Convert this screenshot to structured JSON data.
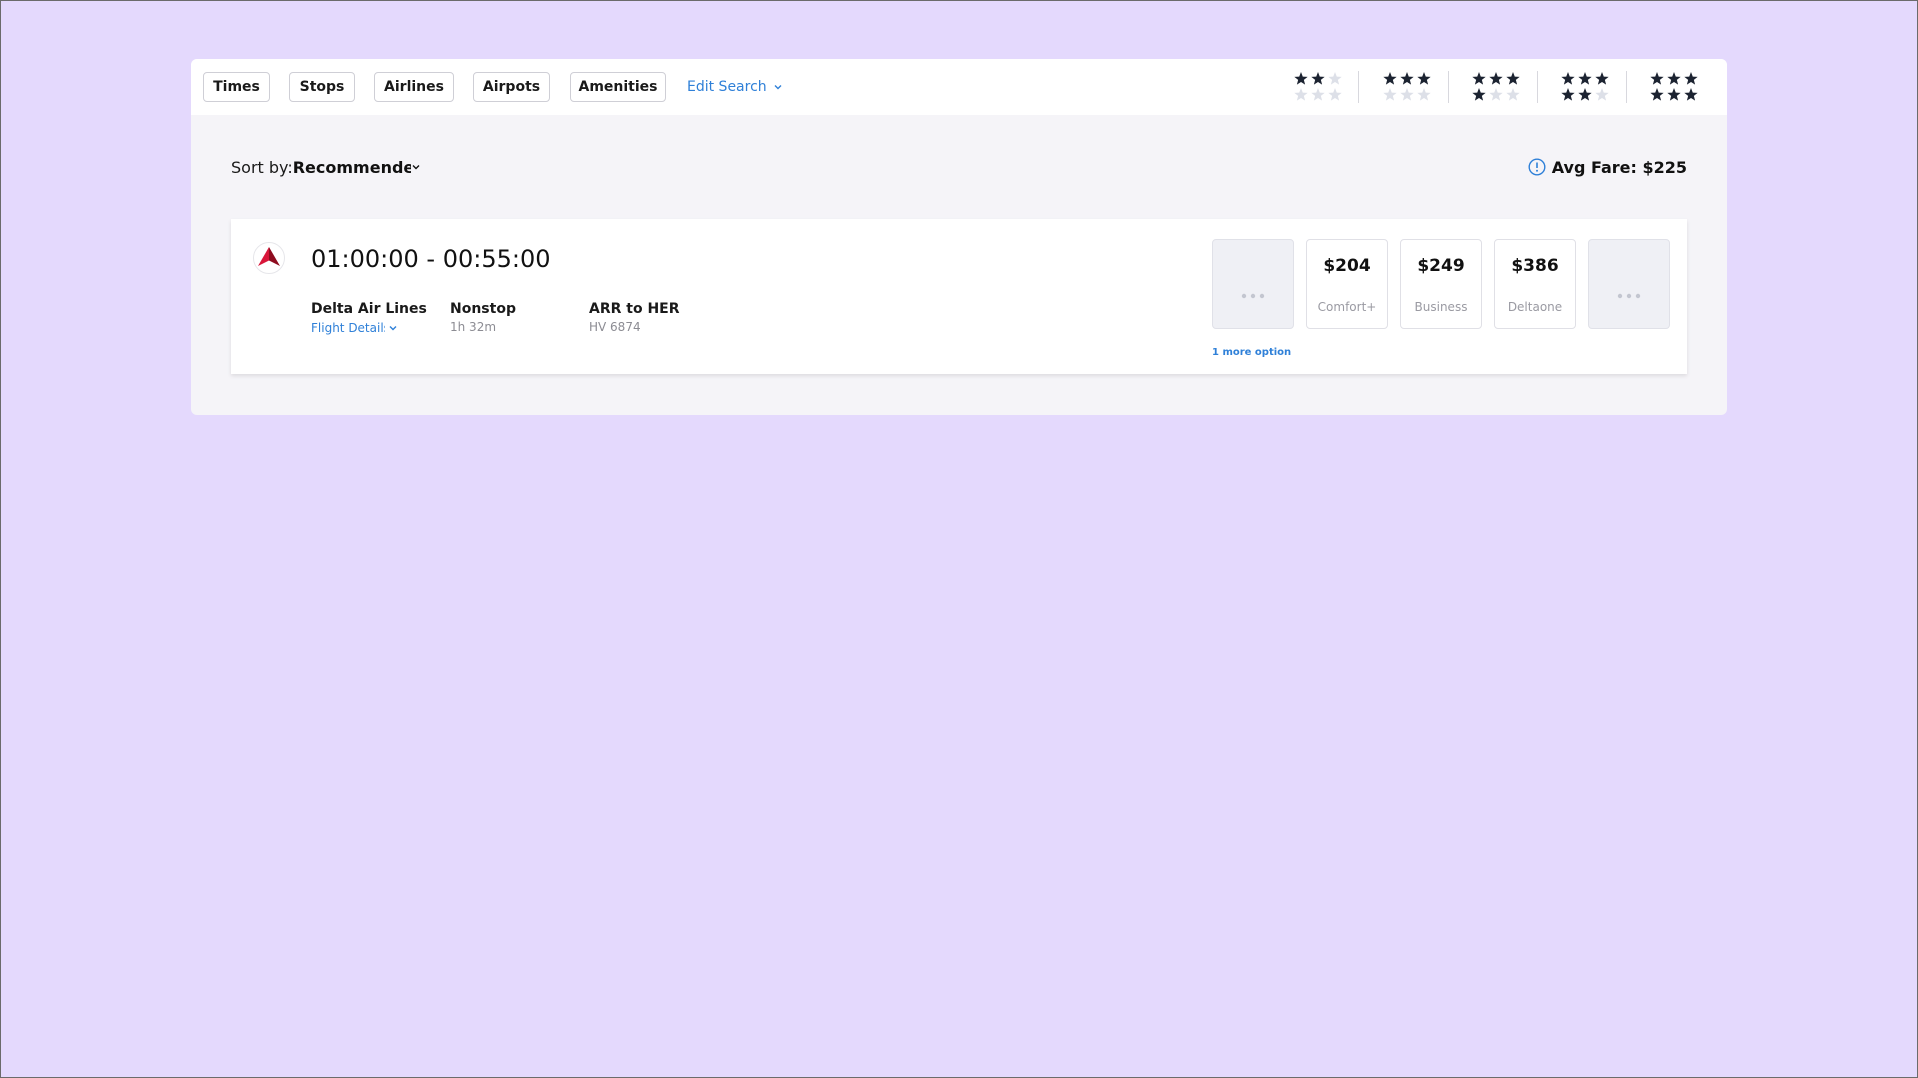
{
  "filters": {
    "buttons": [
      {
        "label": "Times"
      },
      {
        "label": "Stops"
      },
      {
        "label": "Airlines"
      },
      {
        "label": "Airpots"
      },
      {
        "label": "Amenities"
      }
    ],
    "edit_search_label": "Edit Search",
    "star_ratings": [
      2,
      3,
      4,
      5,
      6
    ]
  },
  "sort": {
    "label": "Sort by:",
    "value": "Recommended"
  },
  "avg_fare": {
    "text": "Avg Fare: $225"
  },
  "flight": {
    "airline_logo_icon": "delta-logo-icon",
    "times": "01:00:00 - 00:55:00",
    "airline": "Delta Air Lines",
    "details_link": "Flight Details",
    "stops": "Nonstop",
    "duration": "1h 32m",
    "route": "ARR to HER",
    "flight_number": "HV 6874",
    "fares": [
      {
        "price": "$204",
        "class": "Comfort+"
      },
      {
        "price": "$249",
        "class": "Business"
      },
      {
        "price": "$386",
        "class": "Deltaone"
      }
    ],
    "more_options": "1 more option"
  },
  "colors": {
    "background": "#e4d9fd",
    "accent": "#2f80d8",
    "star_filled": "#1c2331",
    "star_empty": "#dde0e8",
    "delta_red": "#c8102e"
  }
}
